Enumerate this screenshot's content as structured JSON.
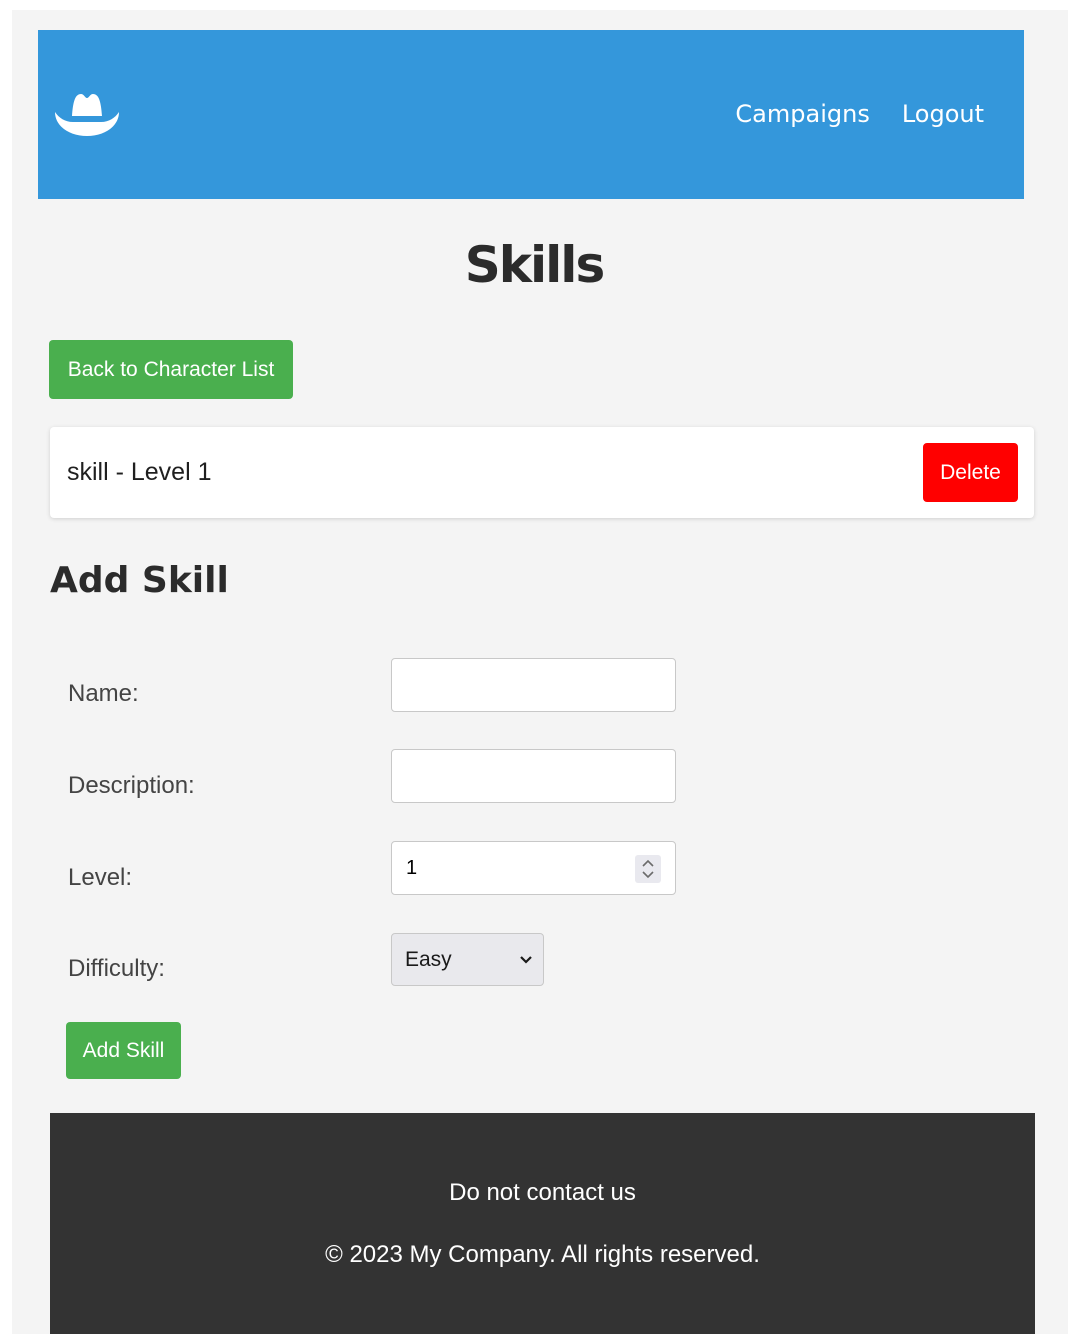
{
  "header": {
    "logo_icon": "cowboy-hat-icon",
    "nav": {
      "campaigns_label": "Campaigns",
      "logout_label": "Logout"
    },
    "background_color": "#3497db"
  },
  "page_title": "Skills",
  "back_button_label": "Back to Character List",
  "skills": [
    {
      "text": "skill - Level 1",
      "delete_label": "Delete"
    }
  ],
  "add_form": {
    "title": "Add Skill",
    "name_label": "Name:",
    "name_value": "",
    "description_label": "Description:",
    "description_value": "",
    "level_label": "Level:",
    "level_value": "1",
    "difficulty_label": "Difficulty:",
    "difficulty_value": "Easy",
    "submit_label": "Add Skill"
  },
  "footer": {
    "line1": "Do not contact us",
    "line2": "© 2023 My Company. All rights reserved."
  },
  "colors": {
    "accent_green": "#4aaf4e",
    "danger_red": "#ff0000",
    "footer_bg": "#333333"
  }
}
